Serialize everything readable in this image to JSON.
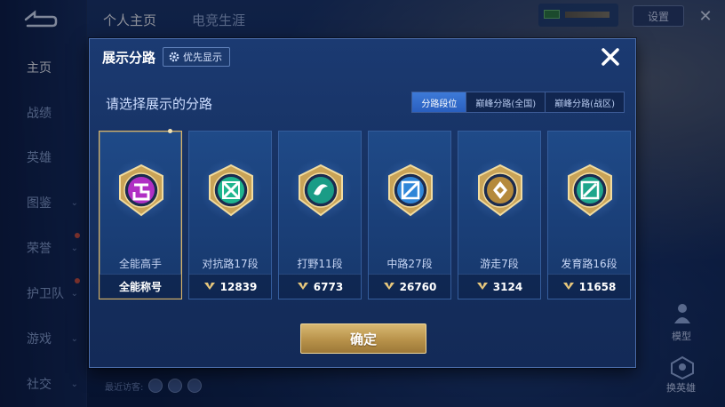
{
  "app": {
    "top_tabs": [
      "个人主页",
      "电竞生涯"
    ],
    "settings_label": "设置",
    "recent_visitors_label": "最近访客:",
    "side": {
      "model_label": "模型",
      "switch_hero_label": "换英雄"
    }
  },
  "left_nav": {
    "items": [
      {
        "label": "主页",
        "active": true,
        "chevron": false
      },
      {
        "label": "战绩",
        "active": false,
        "chevron": false
      },
      {
        "label": "英雄",
        "active": false,
        "chevron": false
      },
      {
        "label": "图鉴",
        "active": false,
        "chevron": true
      },
      {
        "label": "荣誉",
        "active": false,
        "chevron": true
      },
      {
        "label": "护卫队",
        "active": false,
        "chevron": true
      },
      {
        "label": "游戏",
        "active": false,
        "chevron": true
      },
      {
        "label": "社交",
        "active": false,
        "chevron": true
      }
    ]
  },
  "modal": {
    "title": "展示分路",
    "priority_label": "优先显示",
    "subtitle": "请选择展示的分路",
    "tabs": [
      {
        "label": "分路段位",
        "active": true
      },
      {
        "label": "巅峰分路(全国)",
        "active": false
      },
      {
        "label": "巅峰分路(战区)",
        "active": false
      }
    ],
    "cards": [
      {
        "name": "全能高手",
        "bottom": "全能称号",
        "value": "",
        "selected": true,
        "badge_color": "#b02fc4",
        "icon": "omni-icon"
      },
      {
        "name": "对抗路17段",
        "bottom": "",
        "value": "12839",
        "selected": false,
        "badge_color": "#1fb58e",
        "icon": "clash-lane-icon"
      },
      {
        "name": "打野11段",
        "bottom": "",
        "value": "6773",
        "selected": false,
        "badge_color": "#1a9c86",
        "icon": "jungle-icon"
      },
      {
        "name": "中路27段",
        "bottom": "",
        "value": "26760",
        "selected": false,
        "badge_color": "#2f86d8",
        "icon": "mid-lane-icon"
      },
      {
        "name": "游走7段",
        "bottom": "",
        "value": "3124",
        "selected": false,
        "badge_color": "#b58a3c",
        "icon": "roam-icon"
      },
      {
        "name": "发育路16段",
        "bottom": "",
        "value": "11658",
        "selected": false,
        "badge_color": "#1fa68c",
        "icon": "farm-lane-icon"
      }
    ],
    "confirm_label": "确定"
  },
  "colors": {
    "accent_gold": "#d8b46a",
    "tab_active": "#2a5fbf",
    "modal_bg": "#173263"
  }
}
